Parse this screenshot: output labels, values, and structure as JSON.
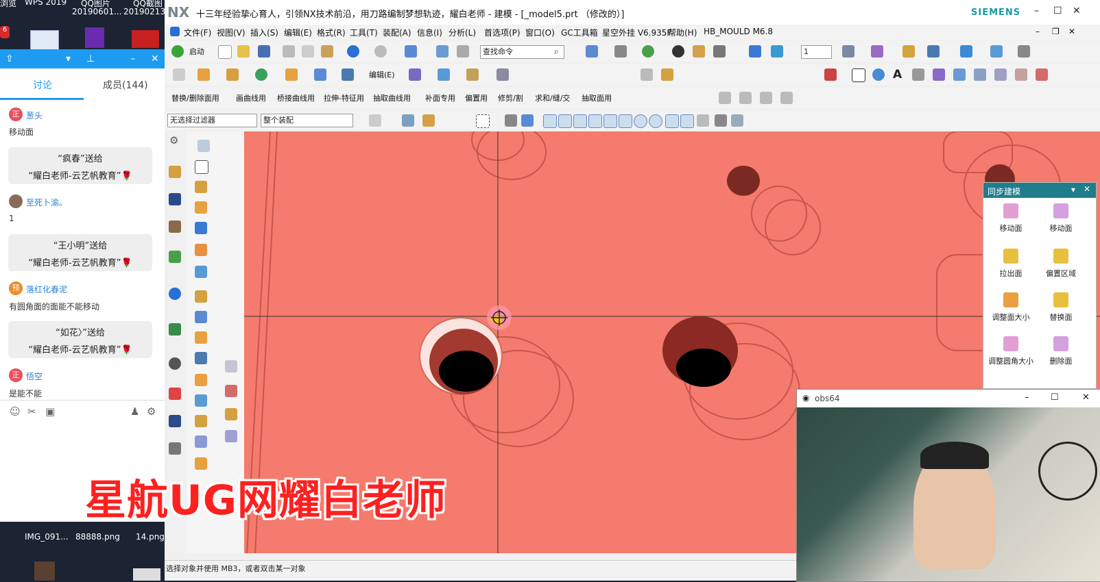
{
  "desktop": {
    "top_labels": [
      "浏览",
      "WPS 2019",
      "QQ图片",
      "QQ截图"
    ],
    "top_labels2": [
      "20190601...",
      "20190213..."
    ],
    "file_labels": [
      "IMG_091...",
      "88888.png",
      "14.png"
    ],
    "badge_count": "6"
  },
  "chat": {
    "tabs": [
      "讨论",
      "成员(144)"
    ],
    "messages": [
      {
        "badge": "正",
        "name": "葱头",
        "text": "移动面",
        "badge_color": "#e8505b"
      },
      {
        "gift_line1": "“疯春”送给",
        "gift_line2": "“耀白老师-云艺帆教育”🌹"
      },
      {
        "badge": "",
        "name": "至死卜渝。",
        "text": "1",
        "badge_color": "#8a6a5a"
      },
      {
        "gift_line1": "“王小明”送给",
        "gift_line2": "“耀白老师-云艺帆教育”🌹"
      },
      {
        "badge": "预",
        "name": "落红化春泥",
        "text": "有圆角面的面能不能移动",
        "badge_color": "#f08a24"
      },
      {
        "gift_line1": "“如花〉”送给",
        "gift_line2": "“耀白老师-云艺帆教育”🌹"
      },
      {
        "badge": "正",
        "name": "悟空",
        "text": "是能不能",
        "badge_color": "#e8505b"
      }
    ]
  },
  "nx": {
    "logo": "NX",
    "title": "十三年经验挚心育人，引领NX技术前沿，用刀路编制梦想轨迹，耀白老师 - 建模 - [_model5.prt （修改的）]",
    "brand": "SIEMENS",
    "menu": [
      "文件(F)",
      "视图(V)",
      "插入(S)",
      "编辑(E)",
      "格式(R)",
      "工具(T)",
      "装配(A)",
      "信息(I)",
      "分析(L)",
      "首选项(P)",
      "窗口(O)",
      "GC工具箱",
      "星空外挂 V6.935F",
      "帮助(H)",
      "HB_MOULD M6.8"
    ],
    "toolbar1": {
      "start_label": "启动",
      "search_placeholder": "查找命令",
      "layer_value": "1"
    },
    "toolbar2": {
      "edit_label": "编辑(E)"
    },
    "toolbar3": [
      "替换/删除面用",
      "画曲线用",
      "桥接曲线用",
      "拉伸-特征用",
      "抽取曲线用",
      "补面专用",
      "偏置用",
      "修剪/割",
      "求和/缝/交",
      "抽取面用"
    ],
    "filter": {
      "type": "无选择过滤器",
      "scope": "整个装配"
    },
    "status": "选择对象并使用 MB3，或者双击某一对象"
  },
  "palette": {
    "title": "同步建模",
    "items": [
      "移动面",
      "移动面",
      "拉出面",
      "偏置区域",
      "调整面大小",
      "替换面",
      "调整圆角大小",
      "删除面"
    ]
  },
  "obs": {
    "title": "obs64"
  },
  "watermark": "星航UG网耀白老师",
  "colors": {
    "graphics_bg": "#f47b6d",
    "chat_blue": "#1d9bf0",
    "palette_title": "#1f7d8c",
    "watermark": "#ff2020"
  }
}
